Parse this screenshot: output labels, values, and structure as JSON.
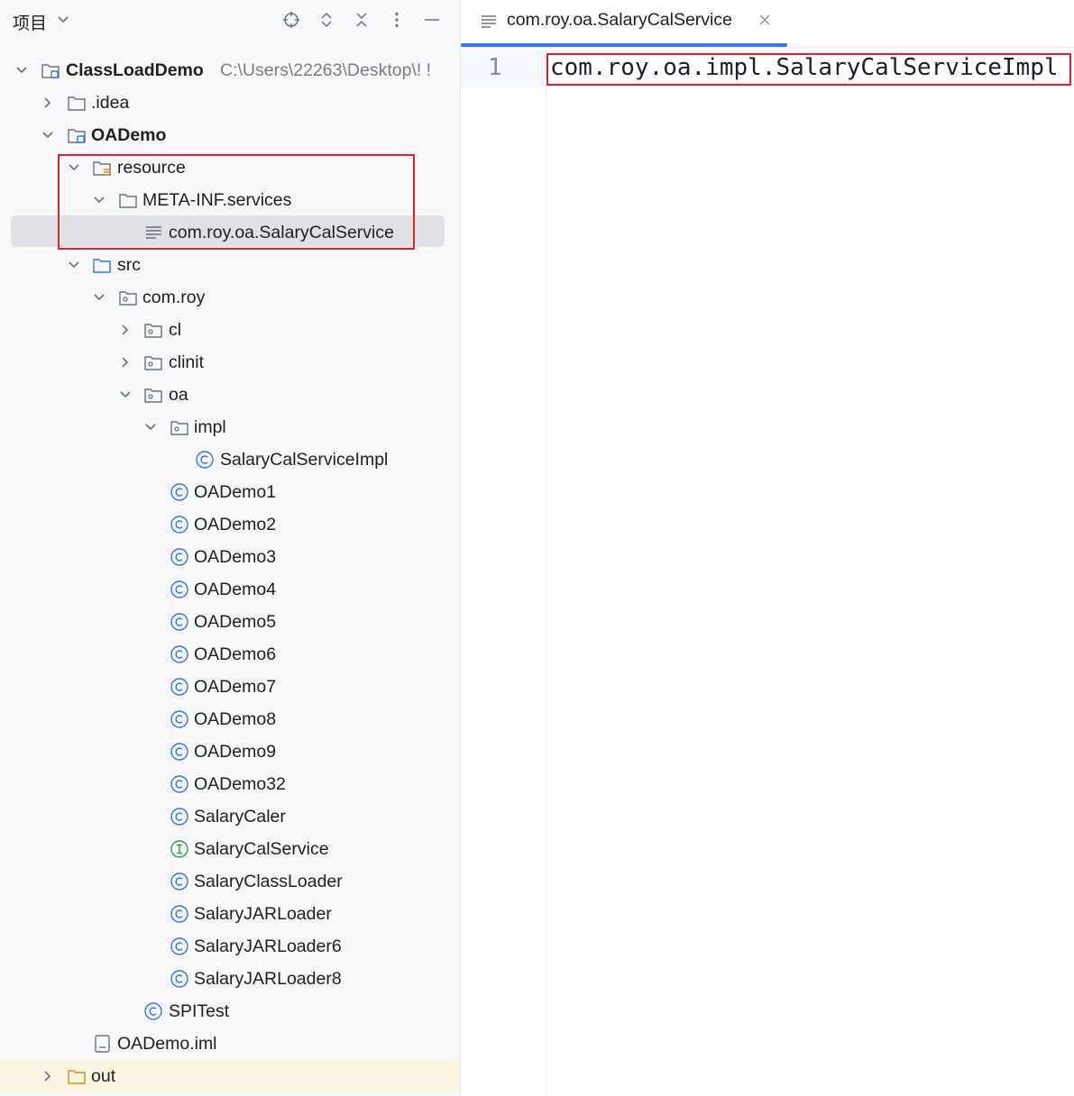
{
  "panel": {
    "title": "项目",
    "header_icons": [
      "locate-icon",
      "expand-collapse-icon",
      "collapse-all-icon",
      "more-options-icon",
      "minimize-icon"
    ]
  },
  "tree": {
    "root_label": "ClassLoadDemo",
    "root_path": "C:\\Users\\22263\\Desktop\\!  !",
    "idea": ".idea",
    "oademo": "OADemo",
    "resource": "resource",
    "meta_inf": "META-INF.services",
    "service_file": "com.roy.oa.SalaryCalService",
    "src": "src",
    "com_roy": "com.roy",
    "cl": "cl",
    "clinit": "clinit",
    "oa": "oa",
    "impl": "impl",
    "salary_impl": "SalaryCalServiceImpl",
    "classes": [
      "OADemo1",
      "OADemo2",
      "OADemo3",
      "OADemo4",
      "OADemo5",
      "OADemo6",
      "OADemo7",
      "OADemo8",
      "OADemo9",
      "OADemo32",
      "SalaryCaler"
    ],
    "interface": "SalaryCalService",
    "classes2": [
      "SalaryClassLoader",
      "SalaryJARLoader",
      "SalaryJARLoader6",
      "SalaryJARLoader8"
    ],
    "spitest": "SPITest",
    "iml": "OADemo.iml",
    "out": "out"
  },
  "editor": {
    "tab_label": "com.roy.oa.SalaryCalService",
    "line_number": "1",
    "code": "com.roy.oa.impl.SalaryCalServiceImpl"
  },
  "colors": {
    "accent": "#3574f0",
    "highlight_box": "#e0202a",
    "class_icon": "#3574f0",
    "interface_icon": "#2e9e44"
  }
}
